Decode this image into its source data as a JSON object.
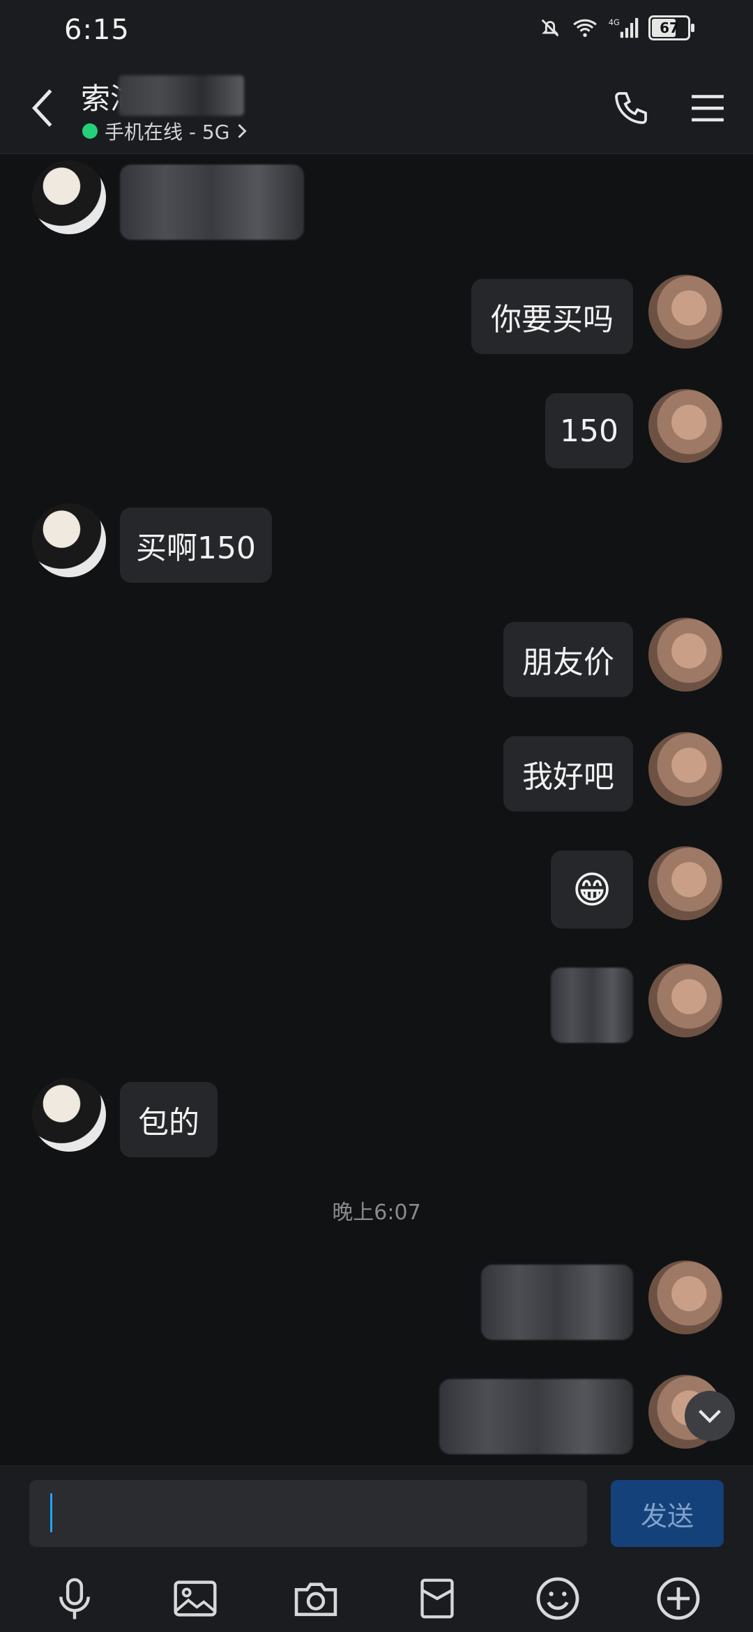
{
  "status_bar": {
    "time": "6:15",
    "battery": "67",
    "network": "4G"
  },
  "header": {
    "title": "索沛",
    "status_text": "手机在线 - 5G",
    "status_color": "#25d07a"
  },
  "messages": [
    {
      "side": "left",
      "text": "",
      "redacted": true
    },
    {
      "side": "right",
      "text": "你要买吗"
    },
    {
      "side": "right",
      "text": "150"
    },
    {
      "side": "left",
      "text": "买啊150"
    },
    {
      "side": "right",
      "text": "朋友价"
    },
    {
      "side": "right",
      "text": "我好吧"
    },
    {
      "side": "right",
      "text": "😁",
      "emoji": true
    },
    {
      "side": "right",
      "text": "",
      "redacted": true
    },
    {
      "side": "left",
      "text": "包的"
    },
    {
      "side": "right",
      "text": "",
      "redacted": true
    },
    {
      "side": "right",
      "text": "",
      "redacted": true
    }
  ],
  "timestamp": "晚上6:07",
  "input": {
    "value": "",
    "placeholder": ""
  },
  "send_label": "发送",
  "colors": {
    "accent": "#1ea3ff",
    "send_bg": "#14417a",
    "bubble": "#26272b",
    "background": "#111214"
  },
  "icons": [
    "back-icon",
    "phone-icon",
    "menu-icon",
    "microphone-icon",
    "image-icon",
    "camera-icon",
    "red-packet-icon",
    "emoji-icon",
    "plus-icon",
    "chevron-down-icon"
  ]
}
